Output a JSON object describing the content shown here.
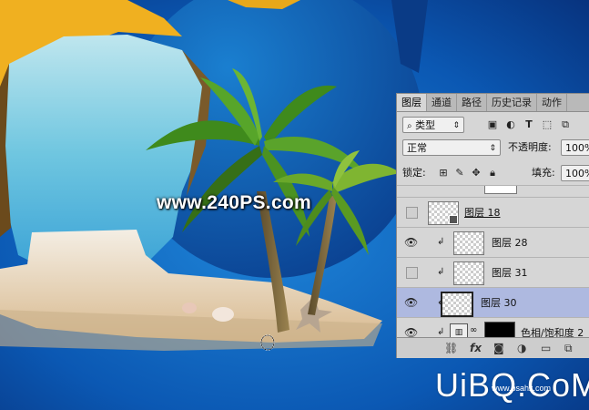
{
  "watermark_text": "www.240PS.com",
  "logo": {
    "main": "UiBQ.CoM",
    "sub": "www.psahz.com"
  },
  "panel": {
    "tabs": [
      "图层",
      "通道",
      "路径",
      "历史记录",
      "动作"
    ],
    "filter": {
      "icon": "search-icon",
      "label": "类型"
    },
    "blend_mode": "正常",
    "opacity_label": "不透明度:",
    "opacity_value": "100%",
    "lock_label": "锁定:",
    "fill_label": "填充:",
    "fill_value": "100%",
    "layers": [
      {
        "name": "图层 18",
        "visible": false,
        "clipped": false,
        "smart": true,
        "selected": false
      },
      {
        "name": "图层 28",
        "visible": true,
        "clipped": true,
        "smart": false,
        "selected": false
      },
      {
        "name": "图层 31",
        "visible": false,
        "clipped": true,
        "smart": false,
        "selected": false
      },
      {
        "name": "图层 30",
        "visible": true,
        "clipped": true,
        "smart": false,
        "selected": true
      },
      {
        "name": "色相/饱和度 2",
        "visible": true,
        "clipped": true,
        "smart": false,
        "selected": false
      }
    ]
  }
}
